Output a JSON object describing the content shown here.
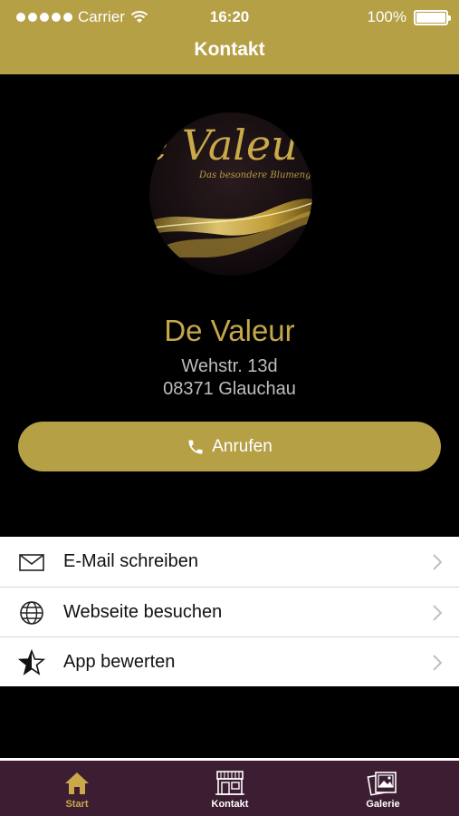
{
  "status_bar": {
    "carrier": "Carrier",
    "time": "16:20",
    "battery": "100%"
  },
  "nav": {
    "title": "Kontakt"
  },
  "logo": {
    "text": "e Valeu",
    "tagline": "Das besondere Blumeng"
  },
  "business": {
    "name": "De Valeur",
    "street": "Wehstr. 13d",
    "city": "08371 Glauchau"
  },
  "actions": {
    "call_label": "Anrufen"
  },
  "list": [
    {
      "label": "E-Mail schreiben",
      "icon": "mail-icon"
    },
    {
      "label": "Webseite besuchen",
      "icon": "globe-icon"
    },
    {
      "label": "App bewerten",
      "icon": "star-icon"
    }
  ],
  "tabs": [
    {
      "label": "Start",
      "icon": "home-icon"
    },
    {
      "label": "Kontakt",
      "icon": "store-icon"
    },
    {
      "label": "Galerie",
      "icon": "gallery-icon"
    }
  ],
  "colors": {
    "accent": "#b5a046",
    "name_gold": "#c4a84b",
    "tabbar": "#3c1d31",
    "active_tab": "#c9a94a"
  }
}
